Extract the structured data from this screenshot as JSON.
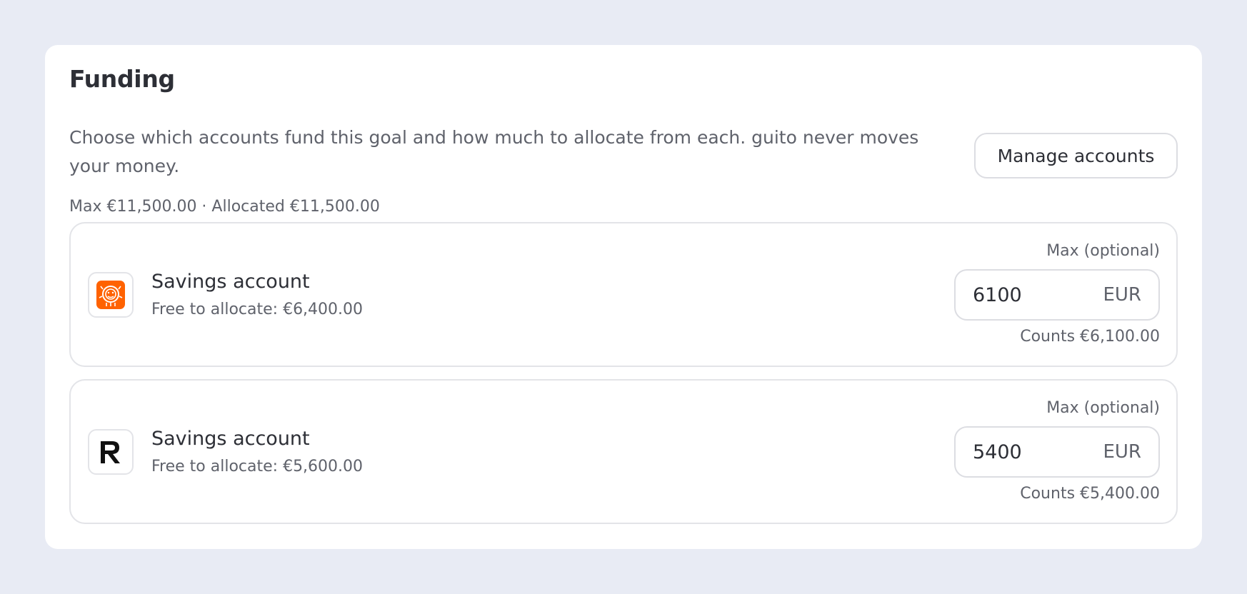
{
  "funding": {
    "title": "Funding",
    "description": "Choose which accounts fund this goal and how much to allocate from each. guito never moves your money.",
    "summary": "Max €11,500.00 · Allocated €11,500.00",
    "manage_button_label": "Manage accounts"
  },
  "accounts": [
    {
      "icon": "ing-lion-logo-icon",
      "brand_color": "#ff6200",
      "name": "Savings account",
      "free_text": "Free to allocate: €6,400.00",
      "max_label": "Max (optional)",
      "max_value": "6100",
      "currency": "EUR",
      "counts_text": "Counts €6,100.00"
    },
    {
      "icon": "revolut-r-logo-icon",
      "brand_color": "#111111",
      "name": "Savings account",
      "free_text": "Free to allocate: €5,600.00",
      "max_label": "Max (optional)",
      "max_value": "5400",
      "currency": "EUR",
      "counts_text": "Counts €5,400.00"
    }
  ]
}
